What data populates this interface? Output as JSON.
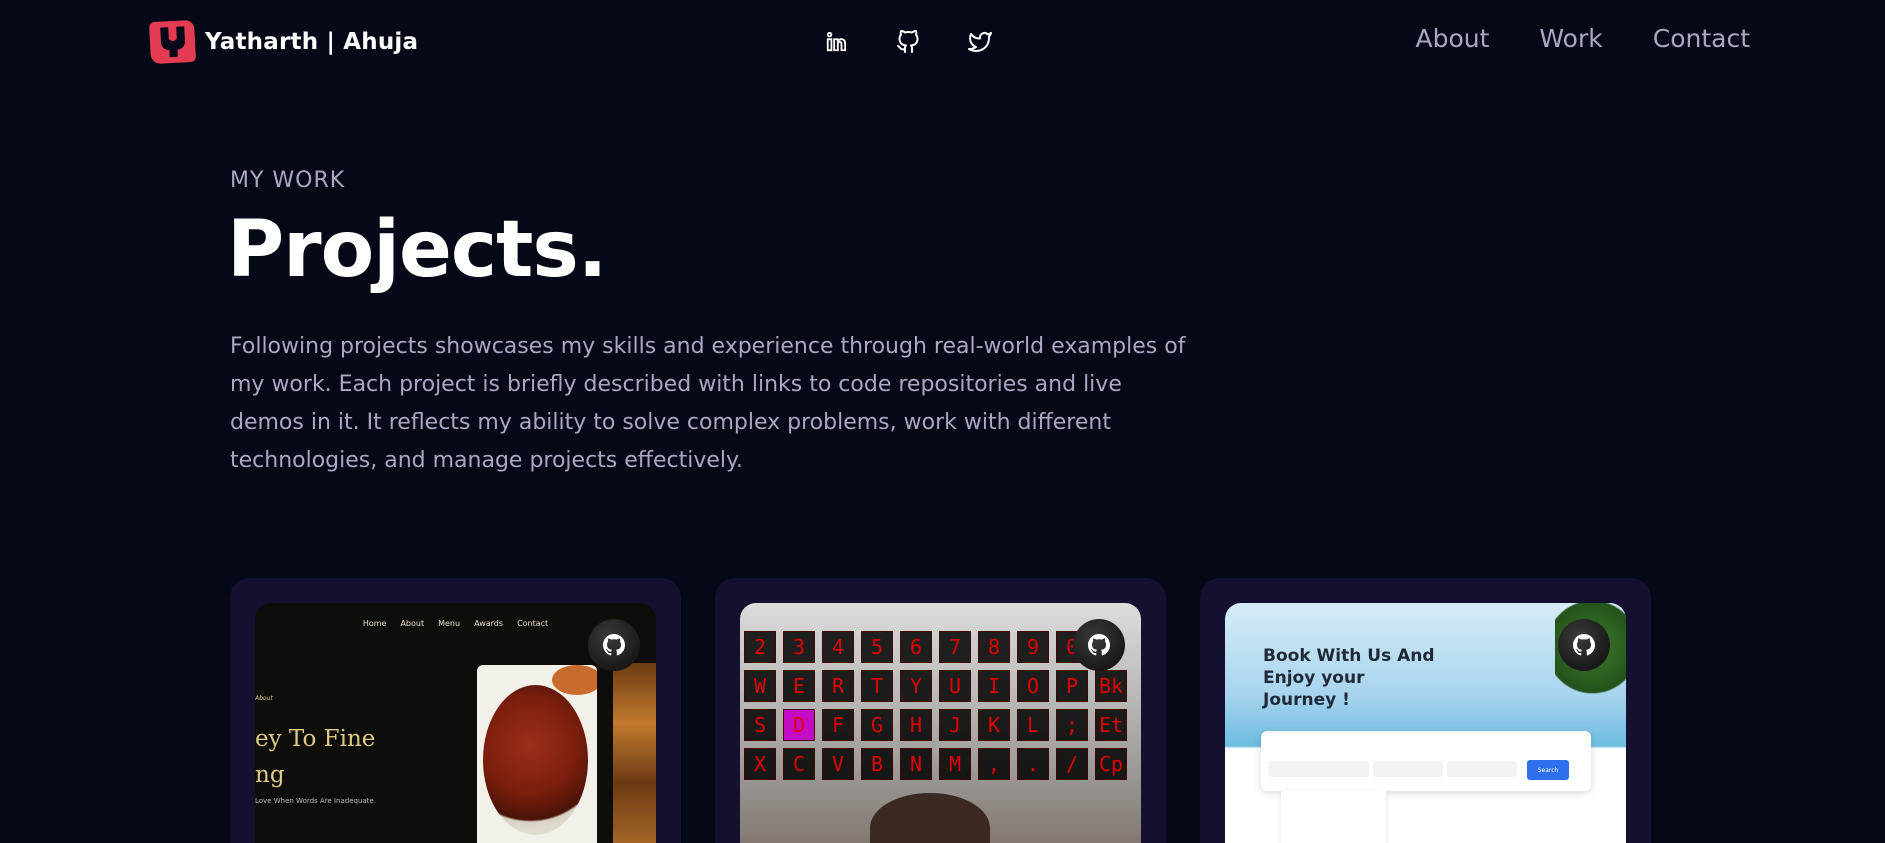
{
  "nav": {
    "brand": "Yatharth | Ahuja",
    "logo_letter": "Y",
    "socials": [
      {
        "name": "linkedin-icon"
      },
      {
        "name": "github-icon"
      },
      {
        "name": "twitter-icon"
      }
    ],
    "links": [
      "About",
      "Work",
      "Contact"
    ]
  },
  "hero": {
    "eyebrow": "MY WORK",
    "title": "Projects.",
    "description": "Following projects showcases my skills and experience through real-world examples of my work. Each project is briefly described with links to code repositories and live demos in it. It reflects my ability to solve complex problems, work with different technologies, and manage projects effectively."
  },
  "projects": [
    {
      "preview": {
        "nav": [
          "Home",
          "About",
          "Menu",
          "Awards",
          "Contact"
        ],
        "small": "About",
        "heading_line1": "ey To Fine",
        "heading_line2": "ng",
        "sub": "Love When Words Are Inadequate."
      }
    },
    {
      "preview": {
        "rows": [
          [
            "2",
            "3",
            "4",
            "5",
            "6",
            "7",
            "8",
            "9",
            "0"
          ],
          [
            "W",
            "E",
            "R",
            "T",
            "Y",
            "U",
            "I",
            "O",
            "P",
            "Bk"
          ],
          [
            "S",
            "D",
            "F",
            "G",
            "H",
            "J",
            "K",
            "L",
            ";",
            "Et"
          ],
          [
            "X",
            "C",
            "V",
            "B",
            "N",
            "M",
            ",",
            ".",
            "/",
            "Cp"
          ]
        ]
      }
    },
    {
      "preview": {
        "title": "Book With Us And Enjoy your Journey !",
        "search": "Search"
      }
    }
  ],
  "colors": {
    "background": "#050816",
    "card": "#151030",
    "secondary_text": "#aaa6c3",
    "logo": "#e23b52"
  }
}
